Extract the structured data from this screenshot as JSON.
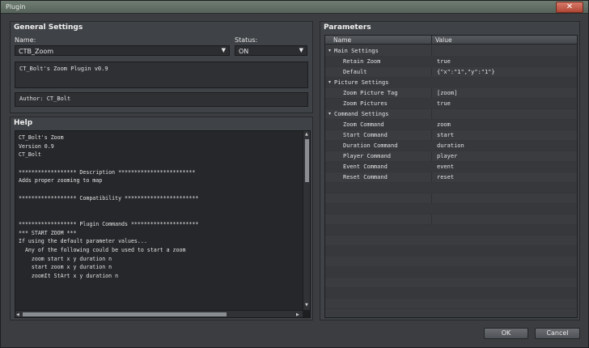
{
  "window": {
    "title": "Plugin",
    "close_glyph": "✕"
  },
  "general": {
    "title": "General Settings",
    "name_label": "Name:",
    "name_value": "CTB_Zoom",
    "status_label": "Status:",
    "status_value": "ON",
    "description": "CT_Bolt's Zoom Plugin v0.9",
    "author": "Author: CT_Bolt"
  },
  "help": {
    "title": "Help",
    "lines": [
      "CT_Bolt's Zoom",
      "Version 0.9",
      "CT_Bolt",
      "",
      "****************** Description ************************",
      "Adds proper zooming to map",
      "",
      "****************** Compatibility ***********************",
      "",
      "",
      "****************** Plugin Commands *********************",
      "*** START ZOOM ***",
      "If using the default parameter values...",
      "  Any of the following could be used to start a zoom",
      "    zoom start x y duration n",
      "    start zoom x y duration n",
      "    zoomIt StArt x y duration n"
    ]
  },
  "parameters": {
    "title": "Parameters",
    "col_name": "Name",
    "col_value": "Value",
    "rows": [
      {
        "group": true,
        "name": "Main Settings",
        "value": ""
      },
      {
        "group": false,
        "name": "Retain Zoom",
        "value": "true"
      },
      {
        "group": false,
        "name": "Default",
        "value": "{\"x\":\"1\",\"y\":\"1\"}"
      },
      {
        "group": true,
        "name": "Picture Settings",
        "value": ""
      },
      {
        "group": false,
        "name": "Zoom Picture Tag",
        "value": "[zoom]"
      },
      {
        "group": false,
        "name": "Zoom Pictures",
        "value": "true"
      },
      {
        "group": true,
        "name": "Command Settings",
        "value": ""
      },
      {
        "group": false,
        "name": "Zoom Command",
        "value": "zoom"
      },
      {
        "group": false,
        "name": "Start Command",
        "value": "start"
      },
      {
        "group": false,
        "name": "Duration Command",
        "value": "duration"
      },
      {
        "group": false,
        "name": "Player Command",
        "value": "player"
      },
      {
        "group": false,
        "name": "Event Command",
        "value": "event"
      },
      {
        "group": false,
        "name": "Reset Command",
        "value": "reset"
      }
    ]
  },
  "footer": {
    "ok_label": "OK",
    "cancel_label": "Cancel"
  }
}
